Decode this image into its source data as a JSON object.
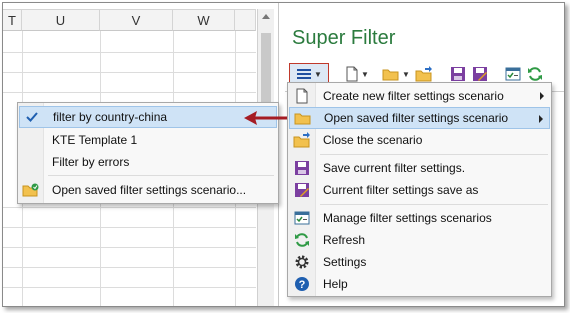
{
  "sheet": {
    "columns": [
      "T",
      "U",
      "V",
      "W"
    ]
  },
  "pane": {
    "title": "Super Filter"
  },
  "menu": {
    "items": [
      {
        "label": "Create new filter settings scenario",
        "icon": "new-document-icon",
        "submenu": true
      },
      {
        "label": "Open saved filter settings scenario",
        "icon": "open-folder-icon",
        "submenu": true,
        "highlighted": true
      },
      {
        "label": "Close the scenario",
        "icon": "close-folder-icon"
      },
      {
        "label": "Save current filter settings.",
        "icon": "save-icon"
      },
      {
        "label": "Current filter settings save as",
        "icon": "save-as-icon"
      },
      {
        "label": "Manage filter settings scenarios",
        "icon": "manage-icon"
      },
      {
        "label": "Refresh",
        "icon": "refresh-icon"
      },
      {
        "label": "Settings",
        "icon": "gear-icon"
      },
      {
        "label": "Help",
        "icon": "help-icon"
      }
    ]
  },
  "submenu": {
    "items": [
      {
        "label": "filter by country-china",
        "icon": "checkmark-icon",
        "highlighted": true
      },
      {
        "label": "KTE Template 1"
      },
      {
        "label": "Filter by errors"
      },
      {
        "label": "Open saved filter settings scenario...",
        "icon": "open-folder-icon"
      }
    ]
  },
  "colors": {
    "title_green": "#2b7b3e",
    "highlight": "#cfe3f6",
    "arrow_red": "#a51c24"
  }
}
